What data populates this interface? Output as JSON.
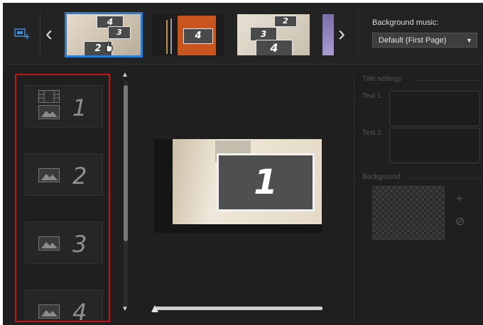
{
  "toolbar": {
    "background_music_label": "Background music:",
    "music_value": "Default (First Page)"
  },
  "templates": [
    {
      "numbers": [
        "4",
        "3",
        "2"
      ]
    },
    {
      "numbers": [
        "4"
      ]
    },
    {
      "numbers": [
        "2",
        "3",
        "4"
      ]
    }
  ],
  "slides": [
    {
      "number": "1"
    },
    {
      "number": "2"
    },
    {
      "number": "3"
    },
    {
      "number": "4"
    }
  ],
  "preview": {
    "number": "1"
  },
  "settings": {
    "title_settings": "Title settings",
    "text1": "Text 1",
    "text2": "Text 2",
    "background": "Background"
  },
  "icons": {
    "prev": "‹",
    "next": "›",
    "add": "+",
    "remove": "⊘",
    "up": "▲",
    "down": "▼",
    "caret": "▼"
  },
  "colors": {
    "selection": "#2a7dd6",
    "highlight_box": "#c2151a"
  }
}
